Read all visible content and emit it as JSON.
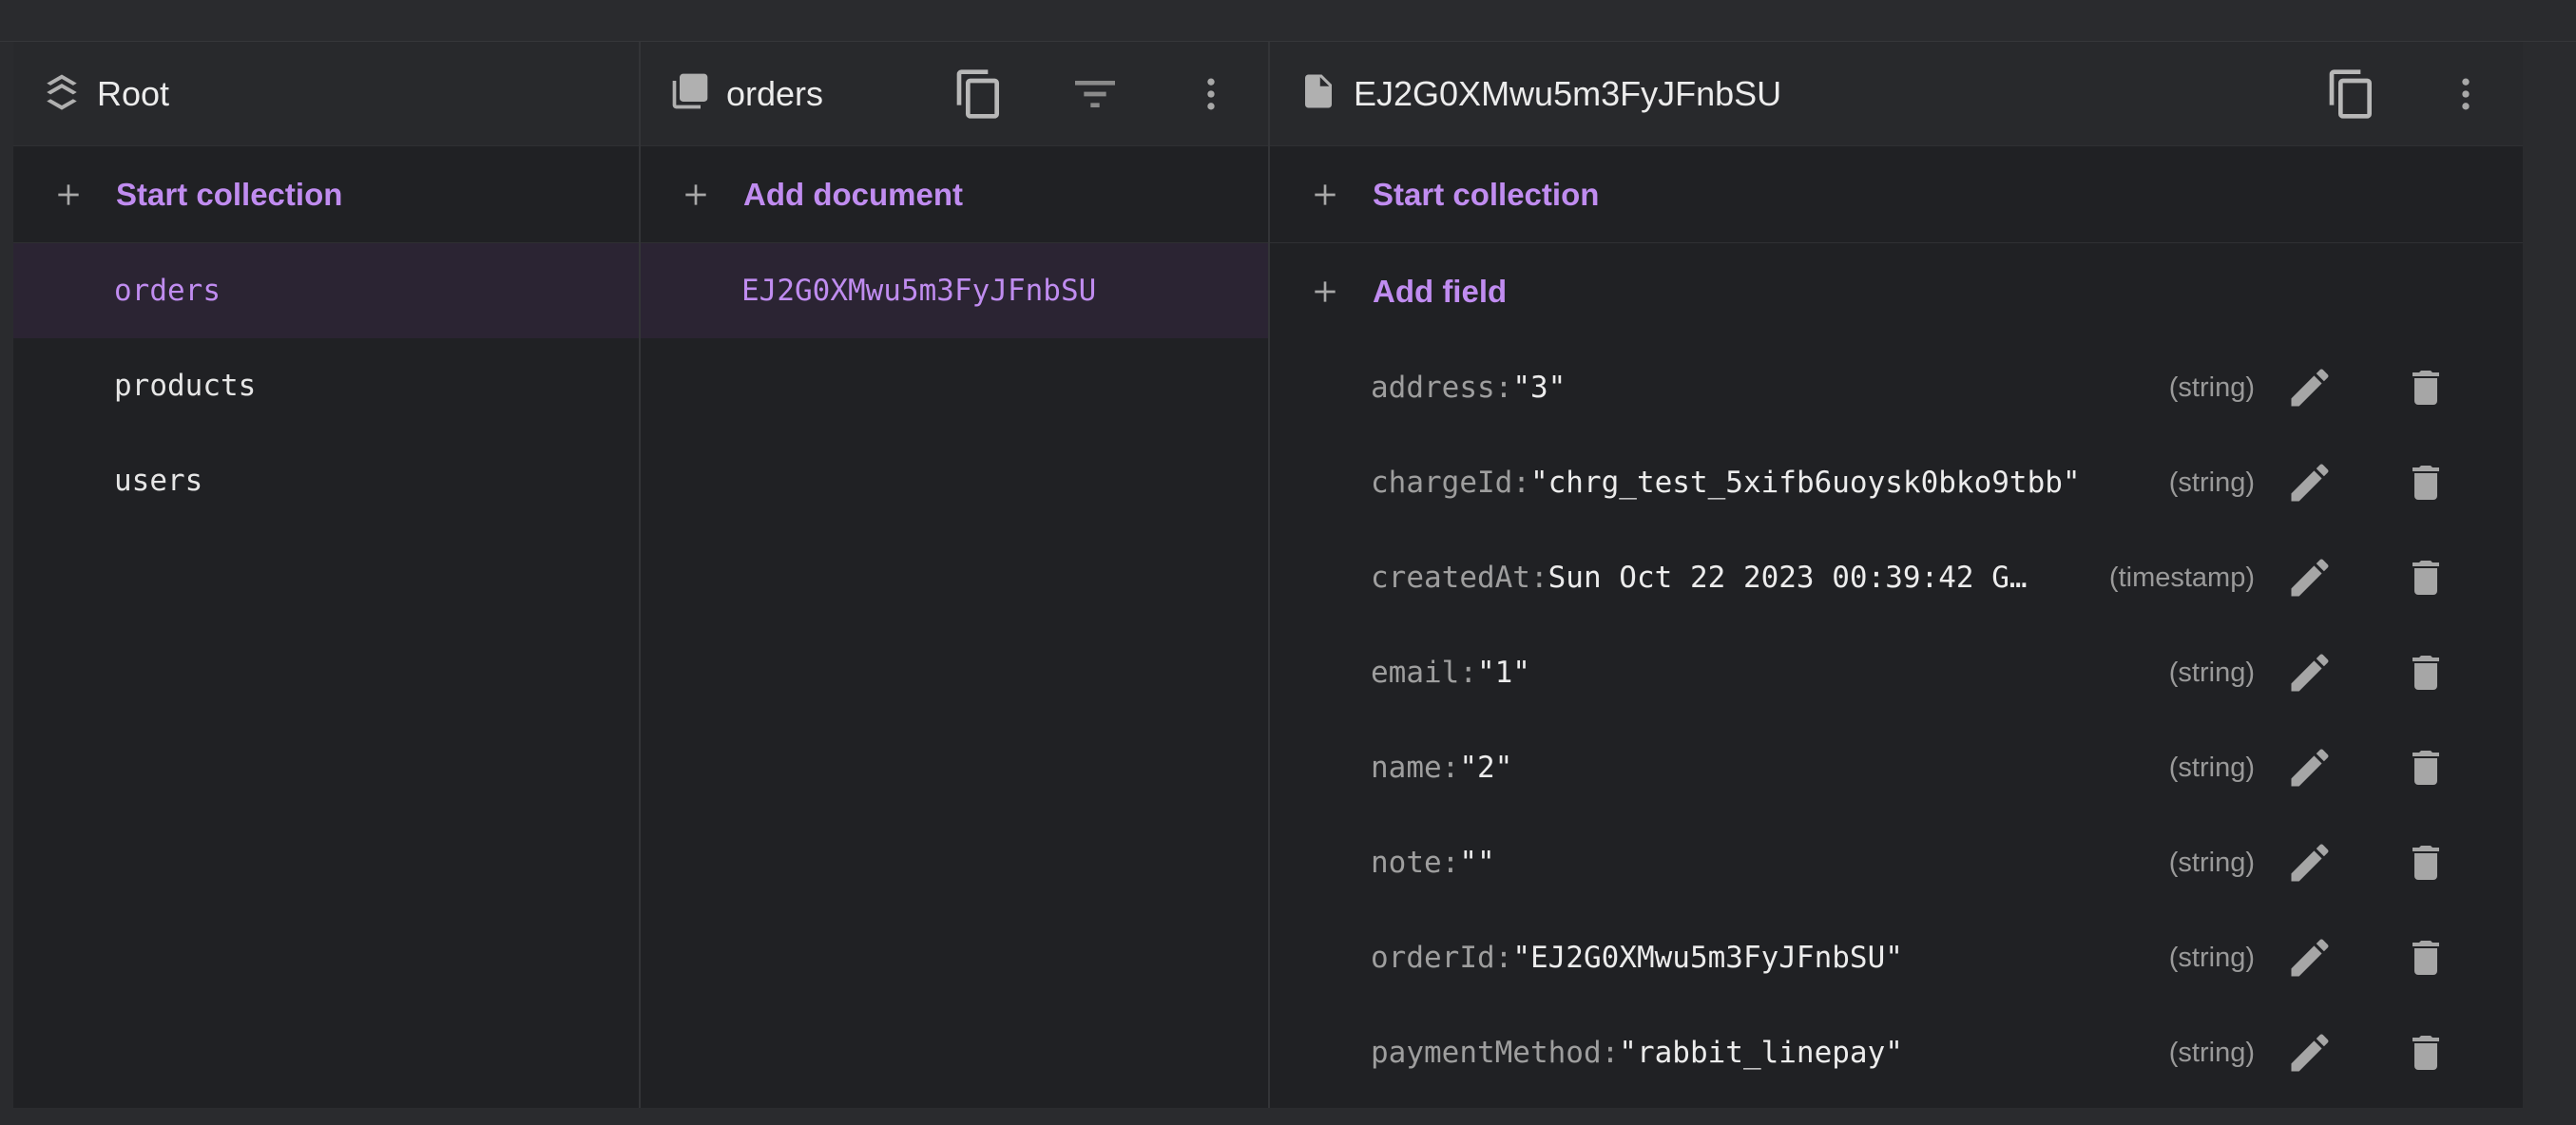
{
  "root_column": {
    "title": "Root",
    "start_collection_label": "Start collection",
    "collections": [
      {
        "label": "orders",
        "selected": true
      },
      {
        "label": "products",
        "selected": false
      },
      {
        "label": "users",
        "selected": false
      }
    ]
  },
  "docs_column": {
    "title": "orders",
    "add_document_label": "Add document",
    "documents": [
      {
        "label": "EJ2G0XMwu5m3FyJFnbSU",
        "selected": true
      }
    ]
  },
  "fields_column": {
    "title": "EJ2G0XMwu5m3FyJFnbSU",
    "start_collection_label": "Start collection",
    "add_field_label": "Add field",
    "fields": [
      {
        "key": "address: ",
        "value": "\"3\"",
        "type": "(string)"
      },
      {
        "key": "chargeId: ",
        "value": "\"chrg_test_5xifb6uoysk0bko9tbb\"",
        "type": "(string)"
      },
      {
        "key": "createdAt: ",
        "value": "Sun Oct 22 2023 00:39:42 G…",
        "type": "(timestamp)"
      },
      {
        "key": "email: ",
        "value": "\"1\"",
        "type": "(string)"
      },
      {
        "key": "name: ",
        "value": "\"2\"",
        "type": "(string)"
      },
      {
        "key": "note: ",
        "value": "\"\"",
        "type": "(string)"
      },
      {
        "key": "orderId: ",
        "value": "\"EJ2G0XMwu5m3FyJFnbSU\"",
        "type": "(string)"
      },
      {
        "key": "paymentMethod: ",
        "value": "\"rabbit_linepay\"",
        "type": "(string)"
      }
    ]
  },
  "colors": {
    "accent": "#c08cf0",
    "background": "#202124",
    "header": "#28292c"
  },
  "icons": [
    "stack-icon",
    "collection-icon",
    "document-icon",
    "copy-icon",
    "filter-icon",
    "more-vert-icon",
    "plus-icon",
    "edit-icon",
    "delete-icon"
  ]
}
